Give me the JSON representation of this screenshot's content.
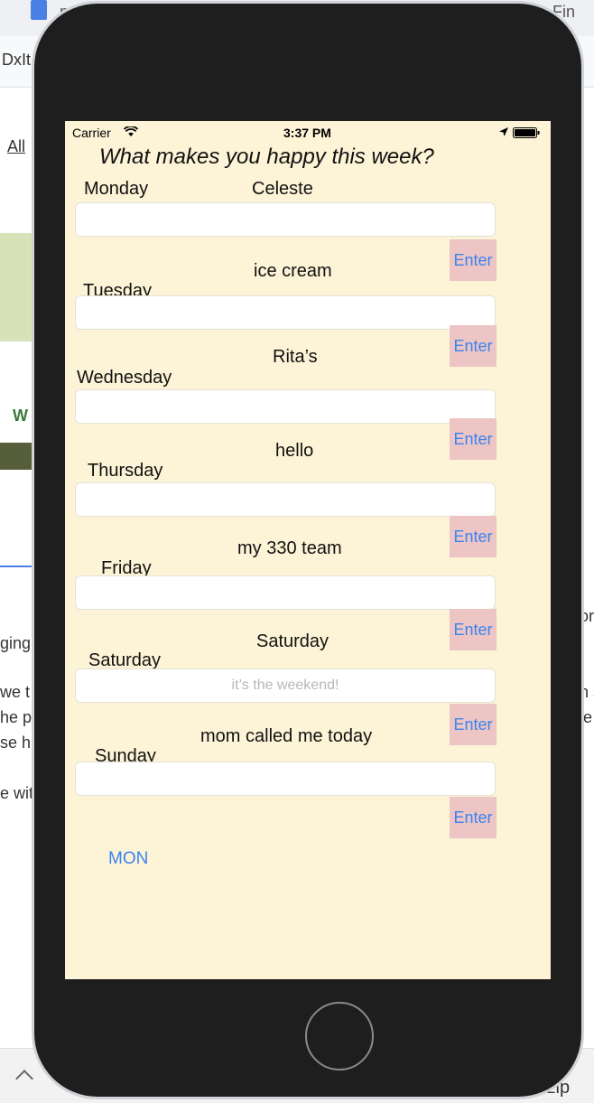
{
  "background": {
    "tabs": [
      "mo",
      "Fin"
    ],
    "left_fragments": [
      "DxIt",
      "All",
      "W",
      "ging",
      "we t",
      "he p",
      "se h",
      "e wit"
    ],
    "right_fragments": [
      "or",
      "n s",
      "ie"
    ],
    "bottom_right": ".zip",
    "bottom_left_icon": "chevron-up-icon"
  },
  "status_bar": {
    "carrier": "Carrier",
    "time": "3:37 PM"
  },
  "app": {
    "title": "What makes you happy this week?",
    "days": [
      {
        "label": "Monday",
        "entry": "Celeste",
        "placeholder": "",
        "button": "Enter"
      },
      {
        "label": "Tuesday",
        "entry": "ice cream",
        "placeholder": "",
        "button": "Enter"
      },
      {
        "label": "Wednesday",
        "entry": "Rita’s",
        "placeholder": "",
        "button": "Enter"
      },
      {
        "label": "Thursday",
        "entry": "hello",
        "placeholder": "",
        "button": "Enter"
      },
      {
        "label": "Friday",
        "entry": "my 330 team",
        "placeholder": "",
        "button": "Enter"
      },
      {
        "label": "Saturday",
        "entry": "Saturday",
        "placeholder": "it’s the weekend!",
        "button": "Enter"
      },
      {
        "label": "Sunday",
        "entry": "mom called me today",
        "placeholder": "",
        "button": "Enter"
      }
    ],
    "mon_button": "MON"
  },
  "colors": {
    "screen_bg": "#fdf3d6",
    "enter_bg": "#edc5c4",
    "link_blue": "#3a84f0",
    "phone_body": "#1e1e1e"
  }
}
